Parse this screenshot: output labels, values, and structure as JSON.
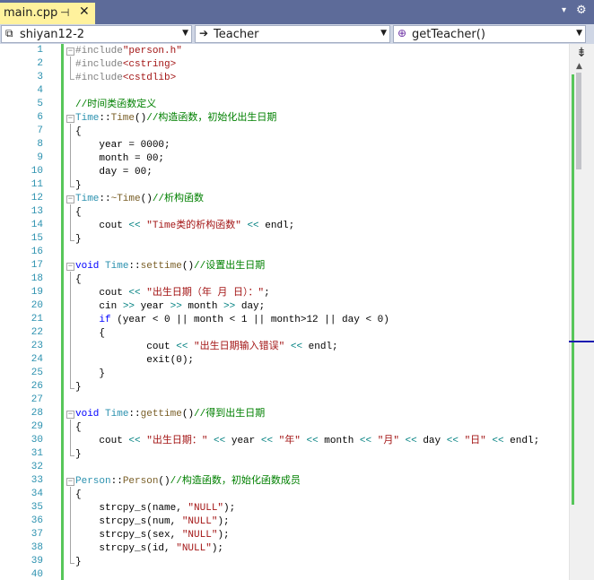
{
  "tab": {
    "title": "main.cpp",
    "pin_glyph": "⊣",
    "close_glyph": "✕"
  },
  "tabstrip": {
    "menu_glyph": "▾",
    "settings_glyph": "⚙"
  },
  "navbar": {
    "project": {
      "icon": "project-icon",
      "glyph": "⧉",
      "label": "shiyan12-2"
    },
    "scope": {
      "icon": "arrow-right-icon",
      "glyph": "➔",
      "label": "Teacher"
    },
    "member": {
      "icon": "method-icon",
      "glyph": "⊕",
      "label": "getTeacher()"
    },
    "dropdown_glyph": "▼"
  },
  "editor": {
    "line_numbers": [
      "1",
      "2",
      "3",
      "4",
      "5",
      "6",
      "7",
      "8",
      "9",
      "10",
      "11",
      "12",
      "13",
      "14",
      "15",
      "16",
      "17",
      "18",
      "19",
      "20",
      "21",
      "22",
      "23",
      "24",
      "25",
      "26",
      "27",
      "28",
      "29",
      "30",
      "31",
      "32",
      "33",
      "34",
      "35",
      "36",
      "37",
      "38",
      "39",
      "40"
    ],
    "lines": [
      [
        [
          "dir",
          "#include"
        ],
        [
          "str",
          "\"person.h\""
        ]
      ],
      [
        [
          "dir",
          "#include"
        ],
        [
          "str",
          "<cstring>"
        ]
      ],
      [
        [
          "dir",
          "#include"
        ],
        [
          "str",
          "<cstdlib>"
        ]
      ],
      [],
      [
        [
          "cmt",
          "//时间类函数定义"
        ]
      ],
      [
        [
          "type",
          "Time"
        ],
        [
          "plain",
          "::"
        ],
        [
          "fn",
          "Time"
        ],
        [
          "plain",
          "()"
        ],
        [
          "cmt",
          "//构造函数，初始化出生日期"
        ]
      ],
      [
        [
          "plain",
          "{"
        ]
      ],
      [
        [
          "plain",
          "    year = 0000;"
        ]
      ],
      [
        [
          "plain",
          "    month = 00;"
        ]
      ],
      [
        [
          "plain",
          "    day = 00;"
        ]
      ],
      [
        [
          "plain",
          "}"
        ]
      ],
      [
        [
          "type",
          "Time"
        ],
        [
          "plain",
          "::"
        ],
        [
          "fn",
          "~Time"
        ],
        [
          "plain",
          "()"
        ],
        [
          "cmt",
          "//析构函数"
        ]
      ],
      [
        [
          "plain",
          "{"
        ]
      ],
      [
        [
          "plain",
          "    cout "
        ],
        [
          "op",
          "<<"
        ],
        [
          "plain",
          " "
        ],
        [
          "str",
          "\"Time类的析构函数\""
        ],
        [
          "plain",
          " "
        ],
        [
          "op",
          "<<"
        ],
        [
          "plain",
          " endl;"
        ]
      ],
      [
        [
          "plain",
          "}"
        ]
      ],
      [],
      [
        [
          "kw",
          "void"
        ],
        [
          "plain",
          " "
        ],
        [
          "type",
          "Time"
        ],
        [
          "plain",
          "::"
        ],
        [
          "fn",
          "settime"
        ],
        [
          "plain",
          "()"
        ],
        [
          "cmt",
          "//设置出生日期"
        ]
      ],
      [
        [
          "plain",
          "{"
        ]
      ],
      [
        [
          "plain",
          "    cout "
        ],
        [
          "op",
          "<<"
        ],
        [
          "plain",
          " "
        ],
        [
          "str",
          "\"出生日期（年 月 日）：\""
        ],
        [
          "plain",
          ";"
        ]
      ],
      [
        [
          "plain",
          "    cin "
        ],
        [
          "op",
          ">>"
        ],
        [
          "plain",
          " year "
        ],
        [
          "op",
          ">>"
        ],
        [
          "plain",
          " month "
        ],
        [
          "op",
          ">>"
        ],
        [
          "plain",
          " day;"
        ]
      ],
      [
        [
          "plain",
          "    "
        ],
        [
          "kw",
          "if"
        ],
        [
          "plain",
          " (year < 0 || month < 1 || month>12 || day < 0)"
        ]
      ],
      [
        [
          "plain",
          "    {"
        ]
      ],
      [
        [
          "plain",
          "            cout "
        ],
        [
          "op",
          "<<"
        ],
        [
          "plain",
          " "
        ],
        [
          "str",
          "\"出生日期输入错误\""
        ],
        [
          "plain",
          " "
        ],
        [
          "op",
          "<<"
        ],
        [
          "plain",
          " endl;"
        ]
      ],
      [
        [
          "plain",
          "            exit(0);"
        ]
      ],
      [
        [
          "plain",
          "    }"
        ]
      ],
      [
        [
          "plain",
          "}"
        ]
      ],
      [],
      [
        [
          "kw",
          "void"
        ],
        [
          "plain",
          " "
        ],
        [
          "type",
          "Time"
        ],
        [
          "plain",
          "::"
        ],
        [
          "fn",
          "gettime"
        ],
        [
          "plain",
          "()"
        ],
        [
          "cmt",
          "//得到出生日期"
        ]
      ],
      [
        [
          "plain",
          "{"
        ]
      ],
      [
        [
          "plain",
          "    cout "
        ],
        [
          "op",
          "<<"
        ],
        [
          "plain",
          " "
        ],
        [
          "str",
          "\"出生日期：\""
        ],
        [
          "plain",
          " "
        ],
        [
          "op",
          "<<"
        ],
        [
          "plain",
          " year "
        ],
        [
          "op",
          "<<"
        ],
        [
          "plain",
          " "
        ],
        [
          "str",
          "\"年\""
        ],
        [
          "plain",
          " "
        ],
        [
          "op",
          "<<"
        ],
        [
          "plain",
          " month "
        ],
        [
          "op",
          "<<"
        ],
        [
          "plain",
          " "
        ],
        [
          "str",
          "\"月\""
        ],
        [
          "plain",
          " "
        ],
        [
          "op",
          "<<"
        ],
        [
          "plain",
          " day "
        ],
        [
          "op",
          "<<"
        ],
        [
          "plain",
          " "
        ],
        [
          "str",
          "\"日\""
        ],
        [
          "plain",
          " "
        ],
        [
          "op",
          "<<"
        ],
        [
          "plain",
          " endl;"
        ]
      ],
      [
        [
          "plain",
          "}"
        ]
      ],
      [],
      [
        [
          "type",
          "Person"
        ],
        [
          "plain",
          "::"
        ],
        [
          "fn",
          "Person"
        ],
        [
          "plain",
          "()"
        ],
        [
          "cmt",
          "//构造函数，初始化函数成员"
        ]
      ],
      [
        [
          "plain",
          "{"
        ]
      ],
      [
        [
          "plain",
          "    strcpy_s(name, "
        ],
        [
          "str",
          "\"NULL\""
        ],
        [
          "plain",
          ");"
        ]
      ],
      [
        [
          "plain",
          "    strcpy_s(num, "
        ],
        [
          "str",
          "\"NULL\""
        ],
        [
          "plain",
          ");"
        ]
      ],
      [
        [
          "plain",
          "    strcpy_s(sex, "
        ],
        [
          "str",
          "\"NULL\""
        ],
        [
          "plain",
          ");"
        ]
      ],
      [
        [
          "plain",
          "    strcpy_s(id, "
        ],
        [
          "str",
          "\"NULL\""
        ],
        [
          "plain",
          ");"
        ]
      ],
      [
        [
          "plain",
          "}"
        ]
      ],
      []
    ],
    "fold_markers": [
      "−",
      "",
      "",
      "",
      "",
      "−",
      "",
      "",
      "",
      "",
      "",
      "−",
      "",
      "",
      "",
      "",
      "−",
      "",
      "",
      "",
      "",
      "",
      "",
      "",
      "",
      "",
      "",
      "−",
      "",
      "",
      "",
      "",
      "−",
      "",
      "",
      "",
      "",
      "",
      "",
      ""
    ]
  },
  "scrollbar": {
    "split_glyph": "⇟",
    "up_glyph": "▲"
  },
  "colors": {
    "tabstrip_bg": "#5d6b99",
    "active_tab_bg": "#fff29d",
    "line_number": "#2b91af",
    "change_bar": "#57c65a",
    "keyword": "#0000ff",
    "string": "#a31515",
    "comment": "#008000",
    "type": "#2b91af",
    "operator": "#008080",
    "directive": "#808080"
  }
}
